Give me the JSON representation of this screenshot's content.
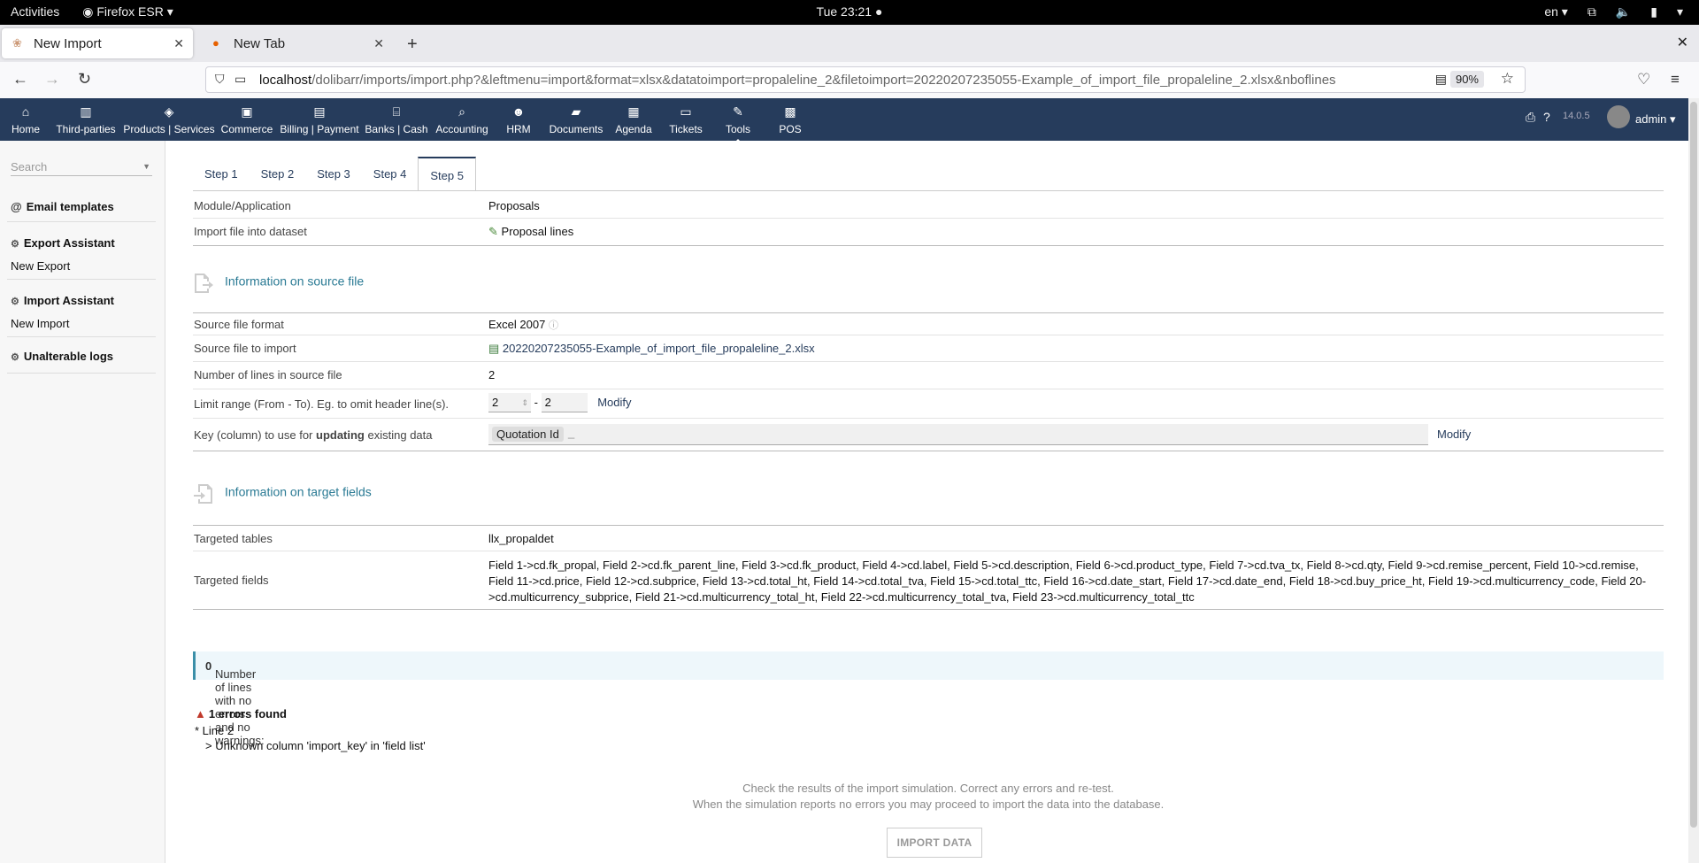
{
  "os": {
    "activities": "Activities",
    "app": "Firefox ESR",
    "clock": "Tue 23:21",
    "lang": "en"
  },
  "browser": {
    "tabs": [
      {
        "title": "New Import"
      },
      {
        "title": "New Tab"
      }
    ],
    "url_host": "localhost",
    "url_path": "/dolibarr/imports/import.php?&leftmenu=import&format=xlsx&datatoimport=propaleline_2&filetoimport=20220207235055-Example_of_import_file_propaleline_2.xlsx&nboflines",
    "zoom": "90%"
  },
  "topmenu": {
    "items": [
      "Home",
      "Third-parties",
      "Products | Services",
      "Commerce",
      "Billing | Payment",
      "Banks | Cash",
      "Accounting",
      "HRM",
      "Documents",
      "Agenda",
      "Tickets",
      "Tools",
      "POS"
    ],
    "version": "14.0.5",
    "user": "admin"
  },
  "sidebar": {
    "search_placeholder": "Search",
    "email_templates": "Email templates",
    "export_assistant": "Export Assistant",
    "new_export": "New Export",
    "import_assistant": "Import Assistant",
    "new_import": "New Import",
    "unalterable_logs": "Unalterable logs"
  },
  "steps": [
    "Step 1",
    "Step 2",
    "Step 3",
    "Step 4",
    "Step 5"
  ],
  "module": {
    "label": "Module/Application",
    "value": "Proposals"
  },
  "dataset": {
    "label": "Import file into dataset",
    "value": "Proposal lines"
  },
  "source_section": "Information on source file",
  "source_format": {
    "label": "Source file format",
    "value": "Excel 2007"
  },
  "source_file": {
    "label": "Source file to import",
    "value": "20220207235055-Example_of_import_file_propaleline_2.xlsx"
  },
  "num_lines": {
    "label": "Number of lines in source file",
    "value": "2"
  },
  "limit": {
    "label": "Limit range (From - To). Eg. to omit header line(s).",
    "from": "2",
    "to": "2",
    "modify": "Modify"
  },
  "key": {
    "label_pre": "Key (column) to use for ",
    "label_bold": "updating",
    "label_post": " existing data",
    "chip": "Quotation Id",
    "modify": "Modify"
  },
  "target_section": "Information on target fields",
  "targeted_tables": {
    "label": "Targeted tables",
    "value": "llx_propaldet"
  },
  "targeted_fields": {
    "label": "Targeted fields",
    "value": "Field 1->cd.fk_propal, Field 2->cd.fk_parent_line, Field 3->cd.fk_product, Field 4->cd.label, Field 5->cd.description, Field 6->cd.product_type, Field 7->cd.tva_tx, Field 8->cd.qty, Field 9->cd.remise_percent, Field 10->cd.remise, Field 11->cd.price, Field 12->cd.subprice, Field 13->cd.total_ht, Field 14->cd.total_tva, Field 15->cd.total_ttc, Field 16->cd.date_start, Field 17->cd.date_end, Field 18->cd.buy_price_ht, Field 19->cd.multicurrency_code, Field 20->cd.multicurrency_subprice, Field 21->cd.multicurrency_total_ht, Field 22->cd.multicurrency_total_tva, Field 23->cd.multicurrency_total_ttc"
  },
  "info": {
    "text": "Number of lines with no errors and no warnings: ",
    "count": "0",
    "end": "."
  },
  "errors": {
    "title": "1 errors found",
    "line": "* Line 2",
    "msg": "> Unknown column 'import_key' in 'field list'"
  },
  "note1": "Check the results of the import simulation. Correct any errors and re-test.",
  "note2": "When the simulation reports no errors you may proceed to import the data into the database.",
  "import_button": "IMPORT DATA"
}
